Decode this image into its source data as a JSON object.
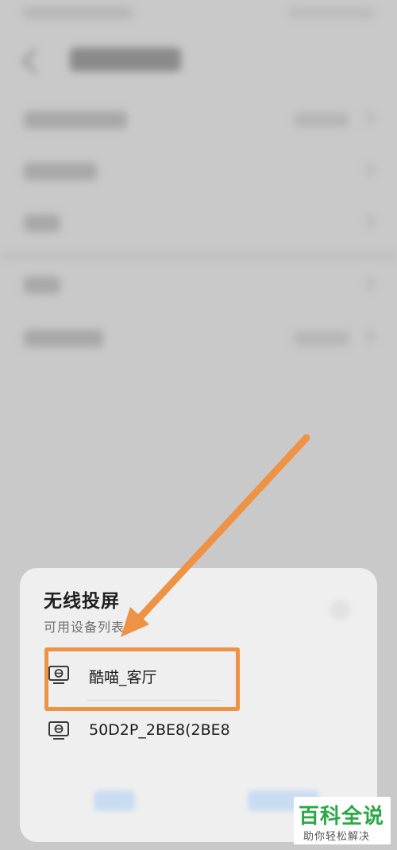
{
  "dialog": {
    "title": "无线投屏",
    "subtitle": "可用设备列表"
  },
  "devices": [
    {
      "name": "酷喵_客厅",
      "icon": "tv-cast-icon"
    },
    {
      "name": "50D2P_2BE8(2BE8",
      "icon": "tv-cast-icon"
    }
  ],
  "watermark": {
    "main": "百科全说",
    "sub": "助你轻松解决"
  },
  "colors": {
    "annotation": "#ee9345",
    "watermark_green": "#2aa845",
    "sheet_bg": "#efefef"
  }
}
